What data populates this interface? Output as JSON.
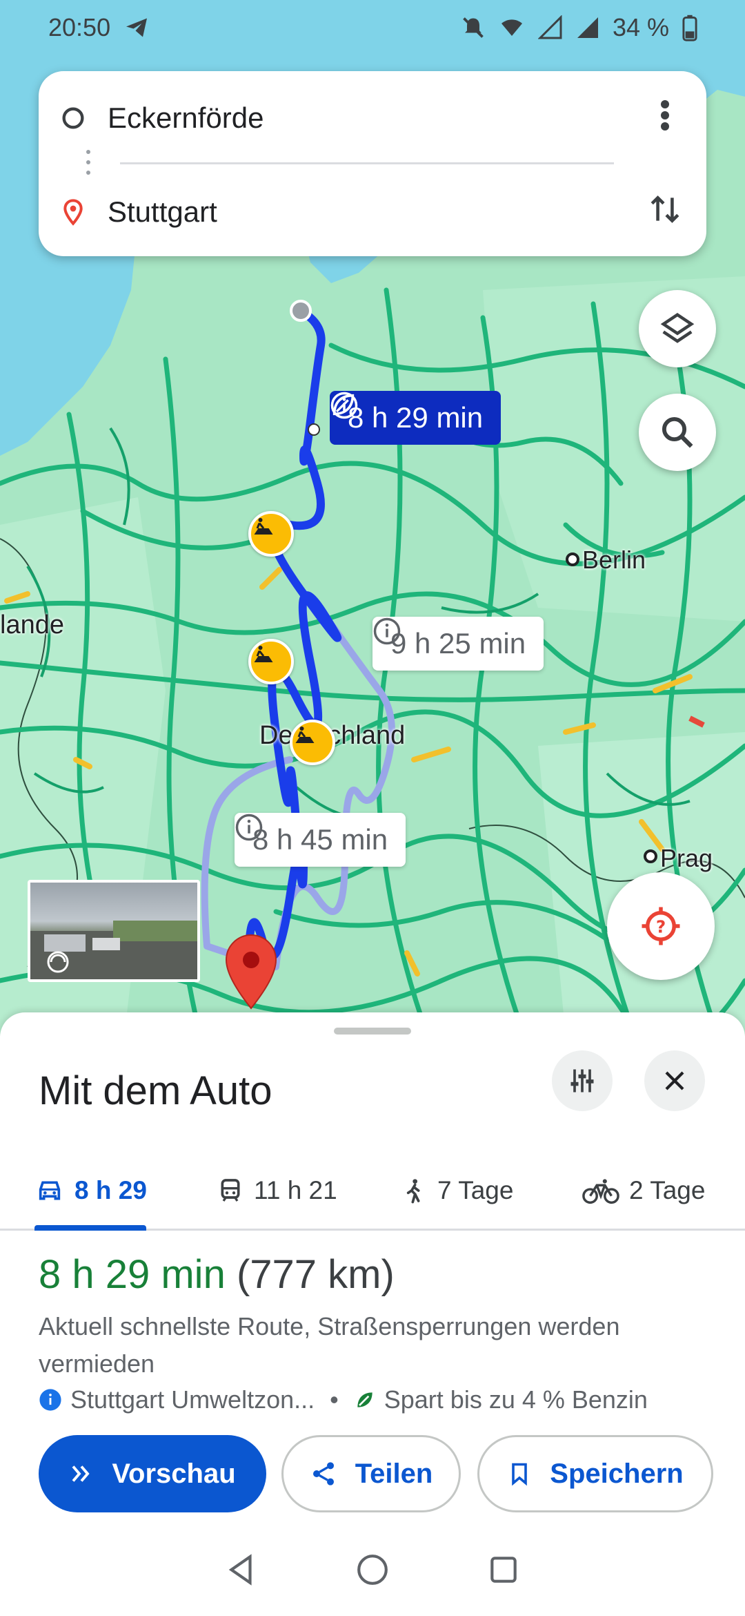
{
  "status_bar": {
    "time": "20:50",
    "battery": "34 %",
    "icons": [
      "telegram-icon",
      "mute-icon",
      "wifi-icon",
      "signal-icon",
      "battery-icon"
    ]
  },
  "route": {
    "start": "Eckernförde",
    "destination": "Stuttgart"
  },
  "map": {
    "labels": {
      "berlin": "Berlin",
      "deutschland": "Deutschland",
      "prag": "Prag",
      "lande": "lande"
    },
    "route_times": {
      "main": "8 h 29 min",
      "alt1": "9 h 25 min",
      "alt2": "8 h 45 min"
    },
    "colors": {
      "main_route": "#1a3dea",
      "alt_route": "#9aa6e8",
      "traffic_free": "#1fb57a",
      "traffic_slow": "#f2c02c",
      "water": "#7fd3e8",
      "land": "#a8e6c4"
    }
  },
  "sheet": {
    "title": "Mit dem Auto",
    "modes": [
      {
        "icon": "car-icon",
        "label": "8 h 29",
        "active": true
      },
      {
        "icon": "train-icon",
        "label": "11 h 21",
        "active": false
      },
      {
        "icon": "walk-icon",
        "label": "7 Tage",
        "active": false
      },
      {
        "icon": "bike-icon",
        "label": "2 Tage",
        "active": false
      }
    ],
    "duration": "8 h 29 min",
    "distance": "(777 km)",
    "description": "Aktuell schnellste Route, Straßensperrungen werden vermieden",
    "info_zone": "Stuttgart Umweltzon...",
    "info_separator": "•",
    "info_fuel": "Spart bis zu 4 % Benzin",
    "buttons": {
      "preview": "Vorschau",
      "share": "Teilen",
      "save": "Speichern"
    }
  }
}
